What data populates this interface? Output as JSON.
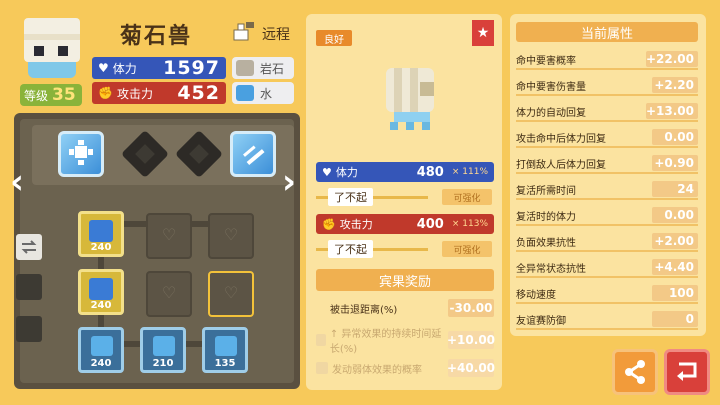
{
  "pokemon": {
    "name": "菊石兽",
    "range": "远程",
    "level_label": "等级",
    "level": "35",
    "hp_label": "体力",
    "hp": "1597",
    "atk_label": "攻击力",
    "atk": "452",
    "types": [
      {
        "label": "岩石",
        "color": "#b8b0a0"
      },
      {
        "label": "水",
        "color": "#4aa0e0"
      }
    ]
  },
  "board": {
    "nodes": [
      {
        "value": "240"
      },
      {
        "value": "240"
      },
      {
        "value": "240"
      },
      {
        "value": "210"
      },
      {
        "value": "135"
      }
    ]
  },
  "stone": {
    "quality": "良好",
    "hp_label": "体力",
    "hp_value": "480",
    "hp_mult": "× 111%",
    "grade1": "了不起",
    "upgrade1": "可强化",
    "atk_label": "攻击力",
    "atk_value": "400",
    "atk_mult": "× 113%",
    "grade2": "了不起",
    "upgrade2": "可强化"
  },
  "bonus": {
    "title": "宾果奖励",
    "rows": [
      {
        "label": "被击退距离(%)",
        "value": "-30.00"
      },
      {
        "label": "↑ 异常效果的持续时间延长(%)",
        "value": "+10.00"
      },
      {
        "label": "发动弱体效果的概率",
        "value": "+40.00"
      }
    ]
  },
  "attributes": {
    "title": "当前属性",
    "rows": [
      {
        "label": "命中要害概率",
        "value": "+22.00"
      },
      {
        "label": "命中要害伤害量",
        "value": "+2.20"
      },
      {
        "label": "体力的自动回复",
        "value": "+13.00"
      },
      {
        "label": "攻击命中后体力回复",
        "value": "0.00"
      },
      {
        "label": "打倒敌人后体力回复",
        "value": "+0.90"
      },
      {
        "label": "复活所需时间",
        "value": "24"
      },
      {
        "label": "复活时的体力",
        "value": "0.00"
      },
      {
        "label": "负面效果抗性",
        "value": "+2.00"
      },
      {
        "label": "全异常状态抗性",
        "value": "+4.40"
      },
      {
        "label": "移动速度",
        "value": "100"
      },
      {
        "label": "友谊赛防御",
        "value": "0"
      }
    ]
  },
  "icons": {
    "share": "share-icon",
    "back": "back-icon",
    "prev": "chevron-left-icon",
    "next": "chevron-right-icon"
  }
}
